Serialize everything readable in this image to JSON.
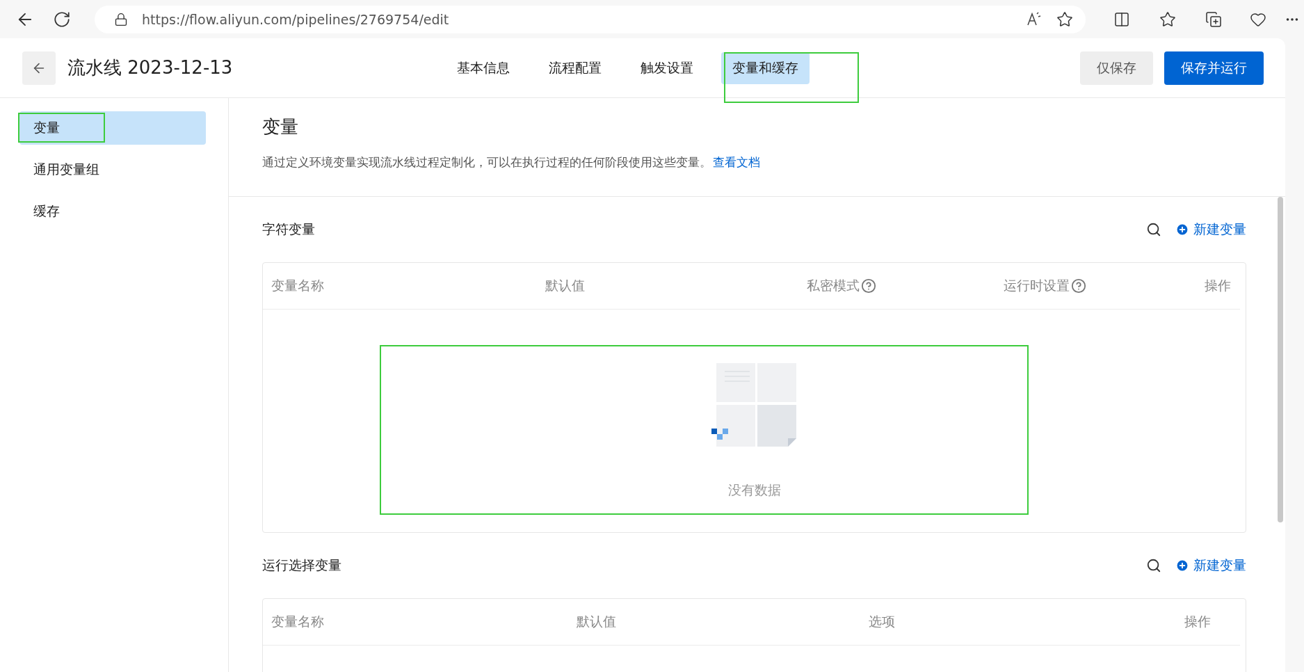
{
  "browser": {
    "url": "https://flow.aliyun.com/pipelines/2769754/edit"
  },
  "header": {
    "title": "流水线 2023-12-13",
    "tabs": [
      {
        "label": "基本信息",
        "selected": false
      },
      {
        "label": "流程配置",
        "selected": false
      },
      {
        "label": "触发设置",
        "selected": false
      },
      {
        "label": "变量和缓存",
        "selected": true
      }
    ],
    "buttons": [
      {
        "label": "仅保存",
        "kind": "secondary"
      },
      {
        "label": "保存并运行",
        "kind": "primary"
      }
    ]
  },
  "sidebar": {
    "items": [
      {
        "label": "变量",
        "selected": true
      },
      {
        "label": "通用变量组",
        "selected": false
      },
      {
        "label": "缓存",
        "selected": false
      }
    ]
  },
  "page": {
    "title": "变量",
    "description": "通过定义环境变量实现流水线过程定制化，可以在执行过程的任何阶段使用这些变量。",
    "link": "查看文档"
  },
  "sections": [
    {
      "title": "字符变量",
      "action": "新建变量",
      "columns": [
        {
          "label": "变量名称",
          "help": false
        },
        {
          "label": "默认值",
          "help": false
        },
        {
          "label": "私密模式",
          "help": true
        },
        {
          "label": "运行时设置",
          "help": true
        },
        {
          "label": "操作",
          "help": false
        }
      ],
      "empty_text": "没有数据"
    },
    {
      "title": "运行选择变量",
      "action": "新建变量",
      "columns": [
        {
          "label": "变量名称",
          "help": false
        },
        {
          "label": "默认值",
          "help": false
        },
        {
          "label": "选项",
          "help": false
        },
        {
          "label": "操作",
          "help": false
        }
      ]
    }
  ]
}
